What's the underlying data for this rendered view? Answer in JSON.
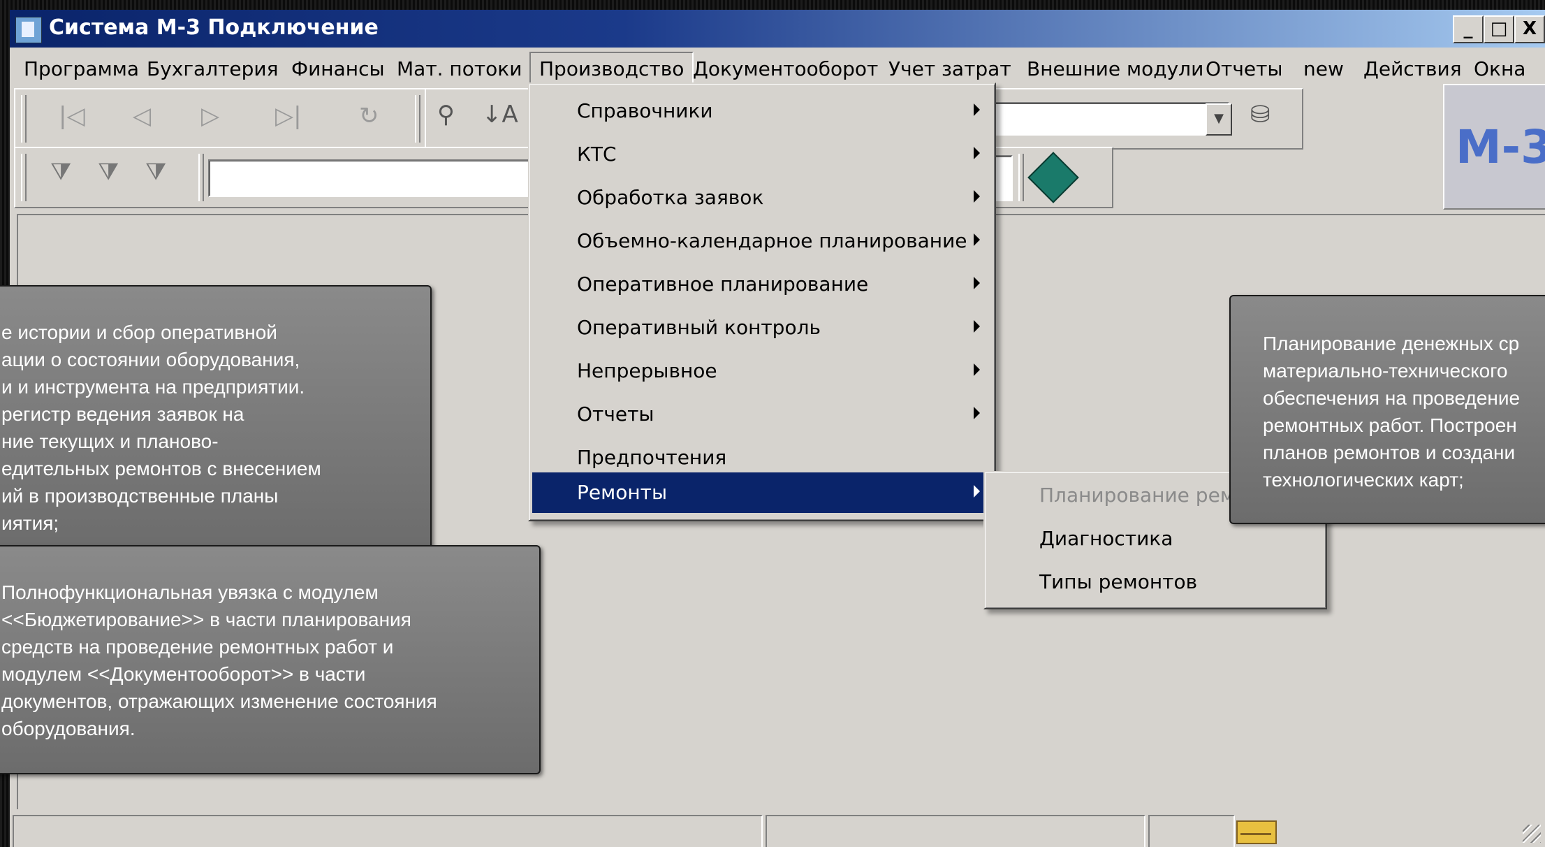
{
  "window": {
    "title": "Система М-3 Подключение",
    "buttons": {
      "minimize": "_",
      "maximize": "□",
      "close": "X"
    }
  },
  "menubar": [
    "Программа",
    "Бухгалтерия",
    "Финансы",
    "Мат. потоки",
    "Производство",
    "Документооборот",
    "Учет затрат",
    "Внешние модули",
    "Отчеты",
    "new",
    "Действия",
    "Окна"
  ],
  "active_menu": "Производство",
  "production_menu": [
    {
      "label": "Справочники",
      "submenu": true
    },
    {
      "label": "КТС",
      "submenu": true
    },
    {
      "label": "Обработка заявок",
      "submenu": true
    },
    {
      "label": "Объемно-календарное планирование",
      "submenu": true
    },
    {
      "label": "Оперативное планирование",
      "submenu": true
    },
    {
      "label": "Оперативный контроль",
      "submenu": true
    },
    {
      "label": "Непрерывное",
      "submenu": true
    },
    {
      "label": "Отчеты",
      "submenu": true
    },
    {
      "label": "Предпочтения",
      "submenu": false
    },
    {
      "label": "Ремонты",
      "submenu": true,
      "selected": true
    }
  ],
  "repairs_submenu": [
    {
      "label": "Планирование ремон",
      "disabled": true
    },
    {
      "label": "Диагностика",
      "disabled": false
    },
    {
      "label": "Типы ремонтов",
      "disabled": false
    }
  ],
  "logo": "М-3",
  "callouts": {
    "left_top": [
      "е истории и сбор оперативной",
      "ации о состоянии оборудования,",
      "и и инструмента на предприятии.",
      "регистр ведения заявок на",
      "ние текущих и планово-",
      "едительных ремонтов с внесением",
      "ий в производственные планы",
      "иятия;"
    ],
    "left_bottom": [
      "Полнофункциональная увязка с модулем",
      "<<Бюджетирование>> в части планирования",
      "средств на проведение ремонтных работ и",
      "модулем <<Документооборот>> в части",
      "документов, отражающих изменение состояния",
      "оборудования."
    ],
    "right": [
      "Планирование денежных ср",
      "материально-технического",
      "обеспечения на проведение",
      "ремонтных работ. Построен",
      "планов ремонтов и создани",
      "технологических карт;"
    ]
  },
  "icons": [
    "nav-first-icon",
    "nav-prev-icon",
    "nav-next-icon",
    "nav-last-icon",
    "refresh-icon",
    "filter-add-icon",
    "filter-edit-icon",
    "filter-clear-icon",
    "run-icon",
    "database-icon",
    "mail-icon"
  ]
}
